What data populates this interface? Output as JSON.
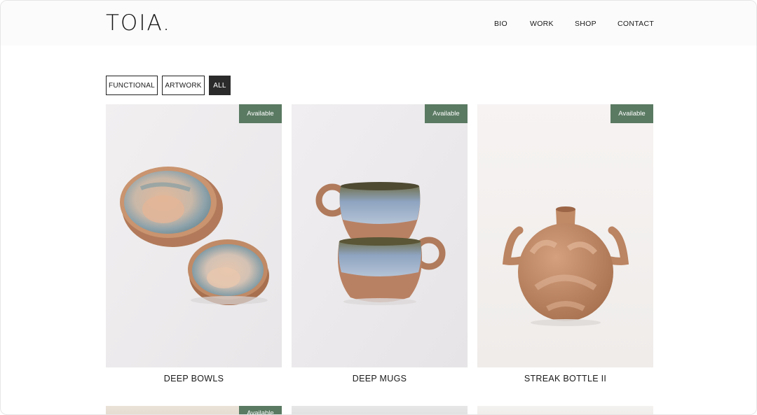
{
  "brand": {
    "logo": "TOIA."
  },
  "nav": {
    "bio": "BIO",
    "work": "WORK",
    "shop": "SHOP",
    "contact": "CONTACT"
  },
  "filters": {
    "functional": "FUNCTIONAL",
    "artwork": "ARTWORK",
    "all": "ALL",
    "active": "ALL"
  },
  "products": [
    {
      "title": "DEEP BOWLS",
      "badge": "Available"
    },
    {
      "title": "DEEP MUGS",
      "badge": "Available"
    },
    {
      "title": "STREAK BOTTLE II",
      "badge": "Available"
    }
  ],
  "next_row": [
    {
      "badge": "Available"
    }
  ],
  "colors": {
    "badge": "#5a7a62",
    "active_filter": "#2b2b2b",
    "text": "#1a1a1a"
  }
}
